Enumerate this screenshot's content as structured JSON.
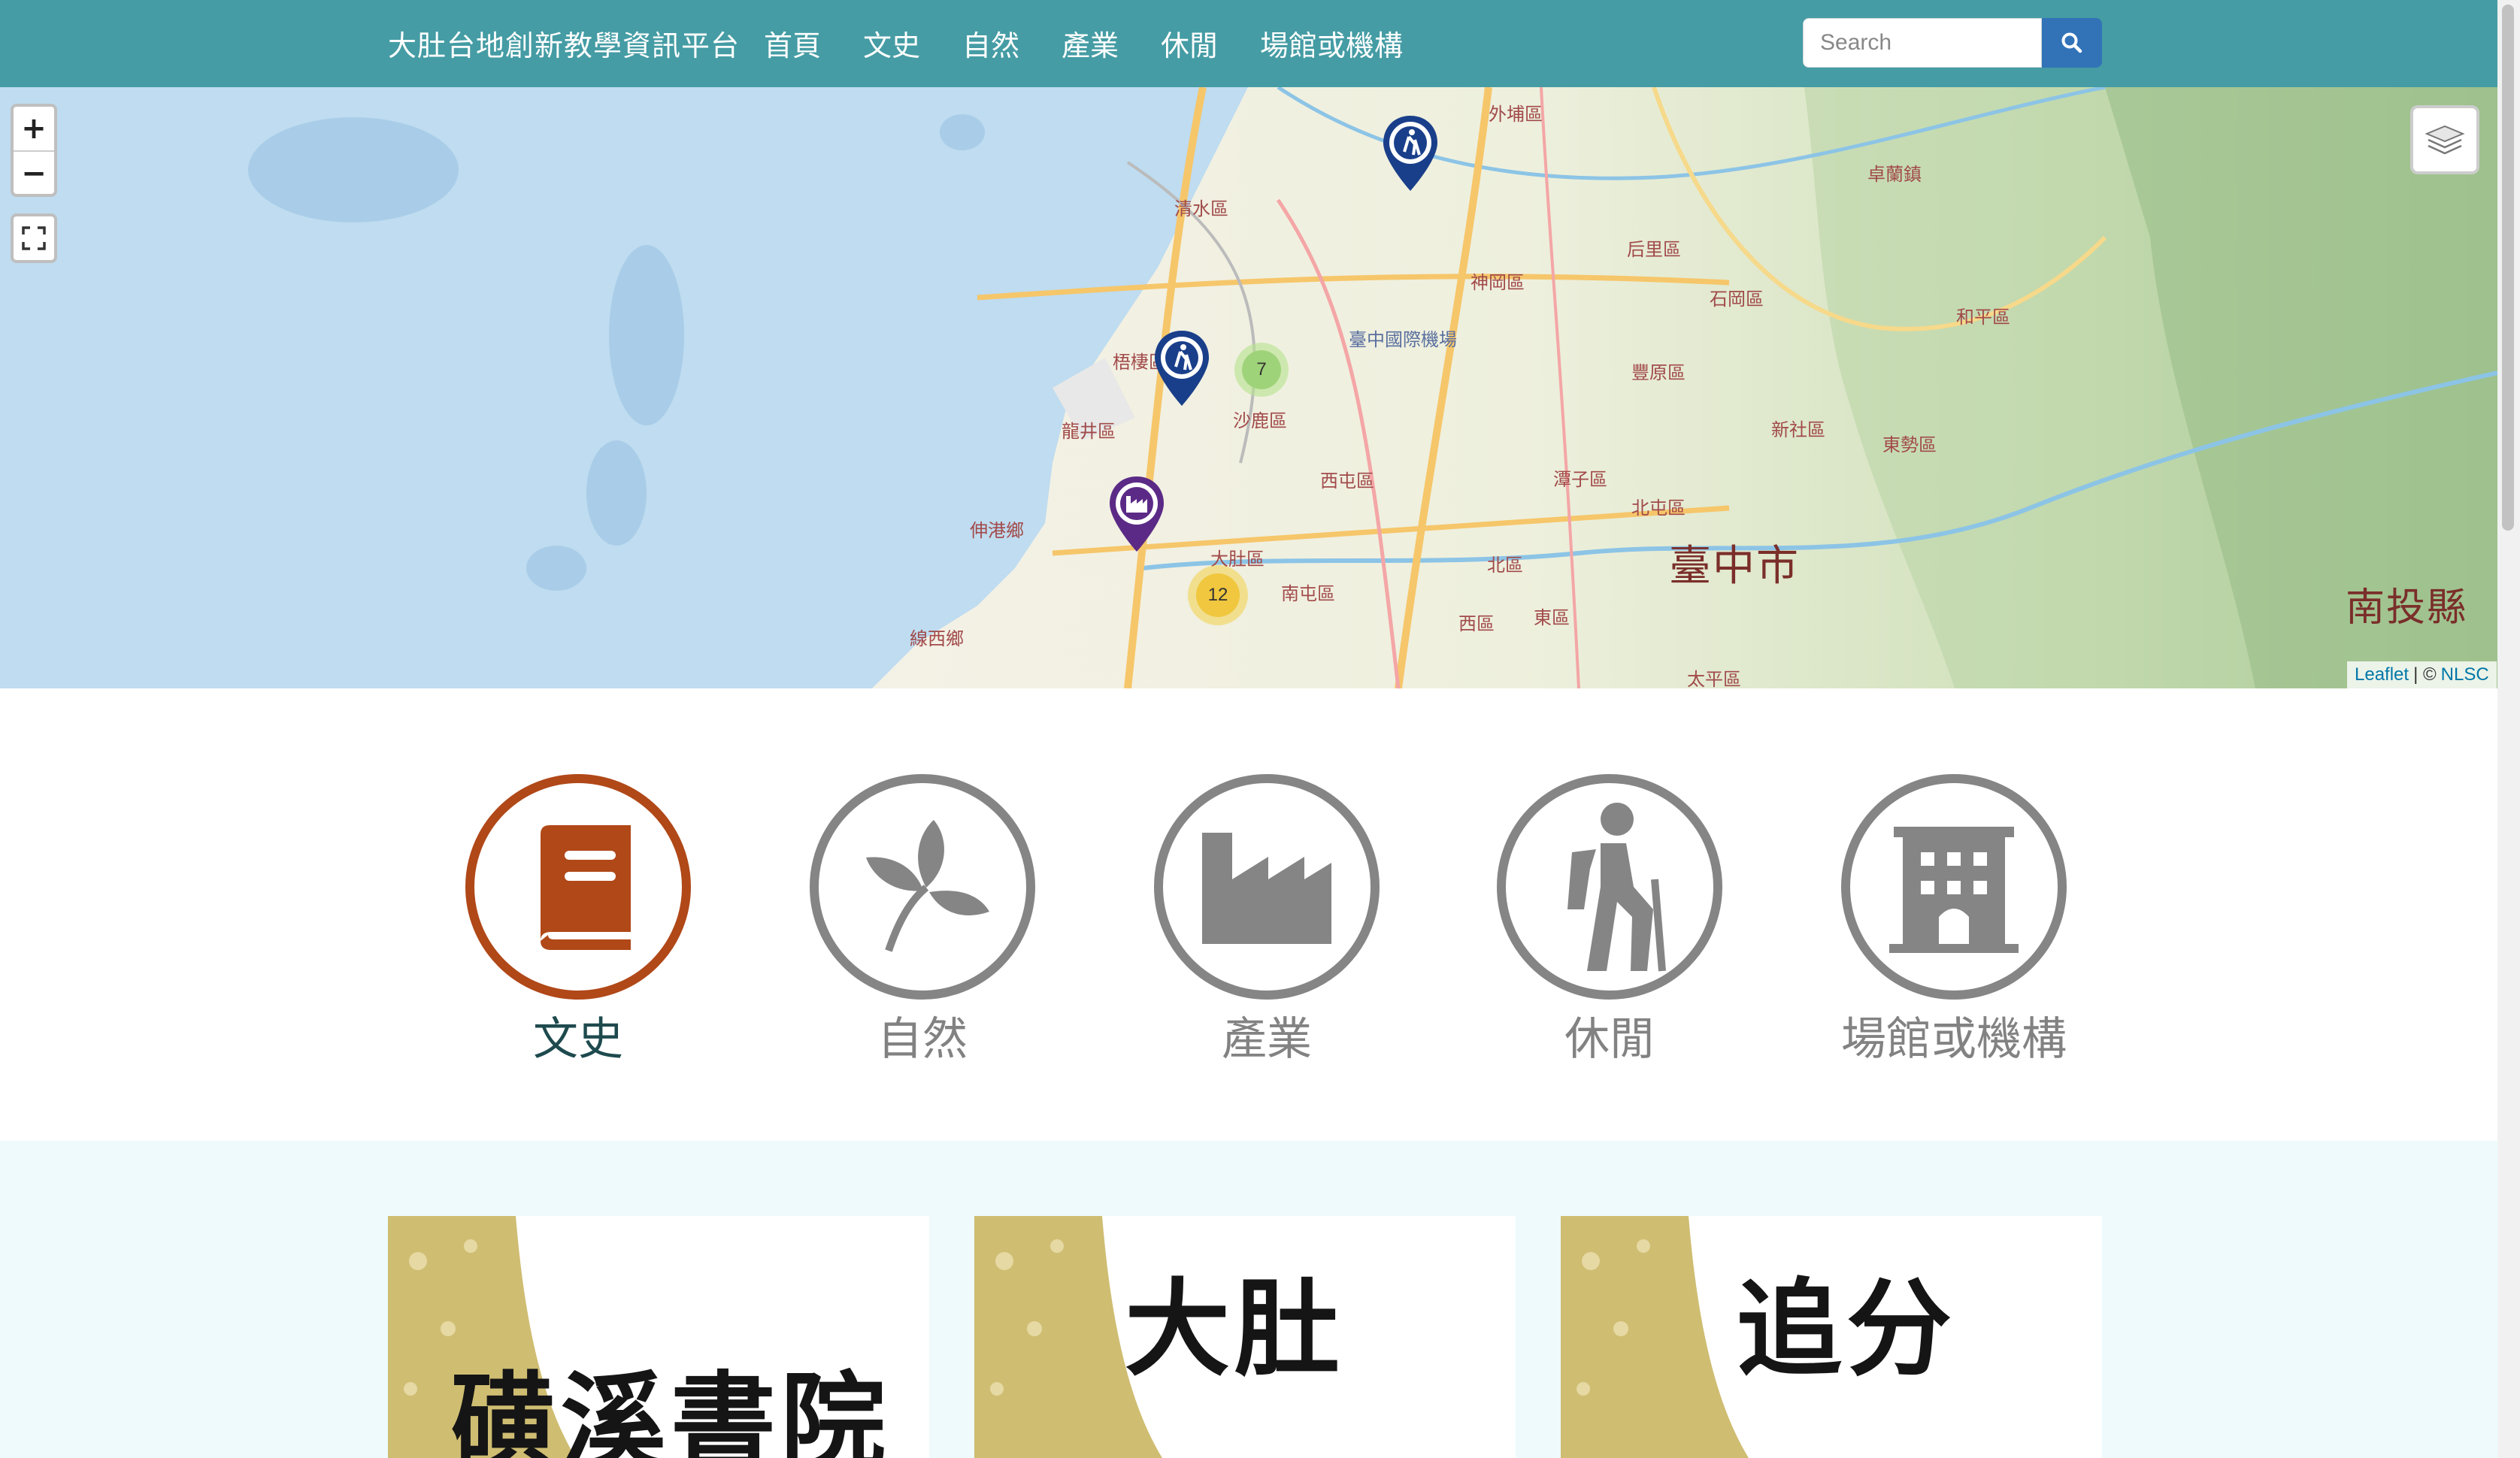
{
  "navbar": {
    "brand": "大肚台地創新教學資訊平台",
    "links": [
      "首頁",
      "文史",
      "自然",
      "產業",
      "休閒",
      "場館或機構"
    ],
    "search_placeholder": "Search",
    "bg_color": "#459ca4"
  },
  "map": {
    "zoom_in": "+",
    "zoom_out": "−",
    "attribution": {
      "leaflet": "Leaflet",
      "sep": "| ©",
      "source": "NLSC"
    },
    "labels": {
      "taichung": "臺中市",
      "nantou": "南投縣",
      "qingshui": "清水區",
      "wuqi": "梧棲區",
      "longjing": "龍井區",
      "shalu": "沙鹿區",
      "dadu": "大肚區",
      "shengang": "伸港鄉",
      "xianxi": "線西鄉",
      "xitun": "西屯區",
      "nantun": "南屯區",
      "beitun": "北屯區",
      "shengang2": "神岡區",
      "houli": "后里區",
      "fengyuan": "豐原區",
      "shigang": "石岡區",
      "dongshi": "東勢區",
      "xinshe": "新社區",
      "taiping": "太平區",
      "daya": "潭子區",
      "bei": "北區",
      "xi": "西區",
      "dong": "東區",
      "heping": "和平區",
      "zhuolan": "卓蘭鎮",
      "waipu": "外埔區",
      "airport": "臺中國際機場"
    },
    "clusters": [
      {
        "count": "7",
        "color": "#9fd37a"
      },
      {
        "count": "12",
        "color": "#f0c73e"
      }
    ]
  },
  "categories": [
    {
      "label": "文史",
      "icon": "book-icon",
      "active": true
    },
    {
      "label": "自然",
      "icon": "leaf-icon",
      "active": false
    },
    {
      "label": "產業",
      "icon": "factory-icon",
      "active": false
    },
    {
      "label": "休閒",
      "icon": "hiking-icon",
      "active": false
    },
    {
      "label": "場館或機構",
      "icon": "building-icon",
      "active": false
    }
  ],
  "cards": [
    {
      "title": "磺溪書院"
    },
    {
      "title": "大肚"
    },
    {
      "title": "追分"
    }
  ]
}
